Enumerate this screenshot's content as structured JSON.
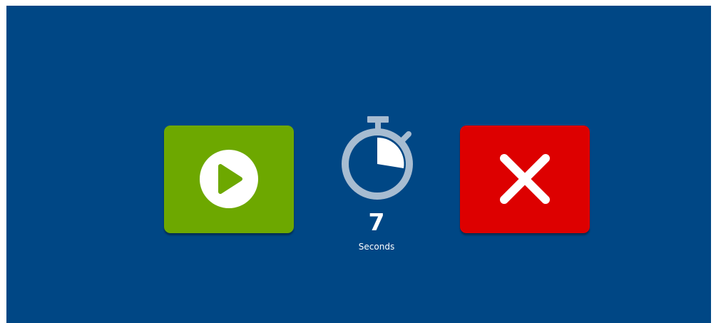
{
  "colors": {
    "background": "#004785",
    "play_button": "#6da800",
    "cancel_button": "#dd0000",
    "timer_ring": "#a7bcd1",
    "timer_fill": "#ffffff"
  },
  "icons": {
    "play": "play-circle-icon",
    "cancel": "close-x-icon",
    "timer": "stopwatch-icon"
  },
  "timer": {
    "value": "7",
    "unit": "Seconds"
  }
}
